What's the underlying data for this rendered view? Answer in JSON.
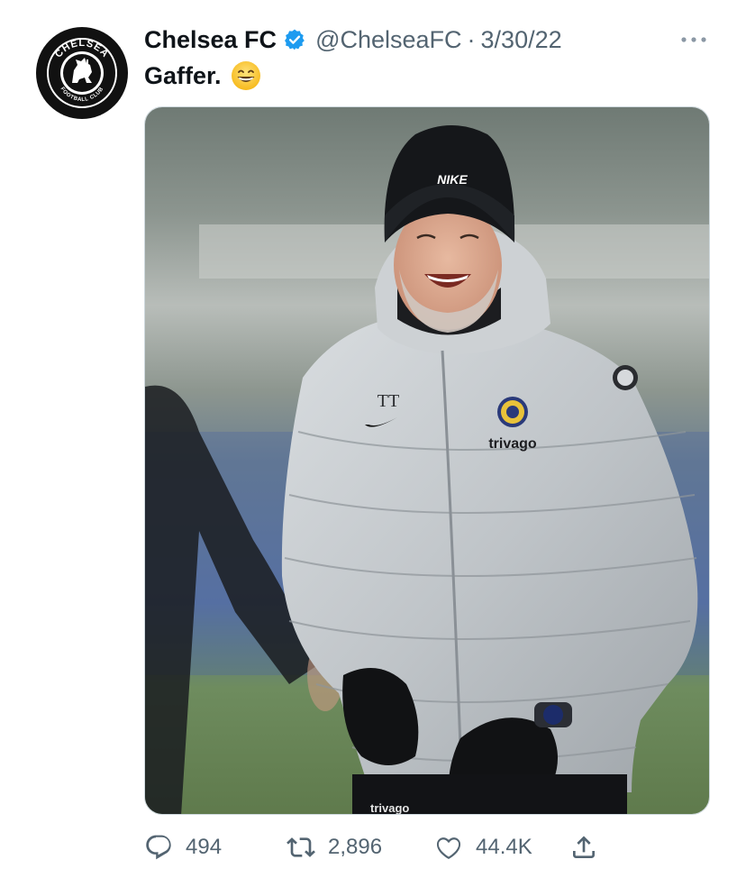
{
  "tweet": {
    "author_name": "Chelsea FC",
    "handle": "@ChelseaFC",
    "separator": "·",
    "date": "3/30/22",
    "text": "Gaffer.",
    "emoji": "grinning-face-with-smiling-eyes",
    "avatar_text": "CHELSEA",
    "avatar_subtext": "FOOTBALL CLUB",
    "media": {
      "hat_logo": "NIKE",
      "initials": "TT",
      "sponsor": "trivago",
      "sponsor_pants": "trivago"
    },
    "stats": {
      "replies": "494",
      "retweets": "2,896",
      "likes": "44.4K"
    }
  },
  "icons": {
    "verified": "verified-badge-icon",
    "more": "more-options-icon",
    "reply": "reply-icon",
    "retweet": "retweet-icon",
    "like": "heart-icon",
    "share": "share-icon"
  },
  "colors": {
    "verified": "#1d9bf0",
    "secondary_text": "#536471",
    "primary_text": "#0f1419"
  }
}
